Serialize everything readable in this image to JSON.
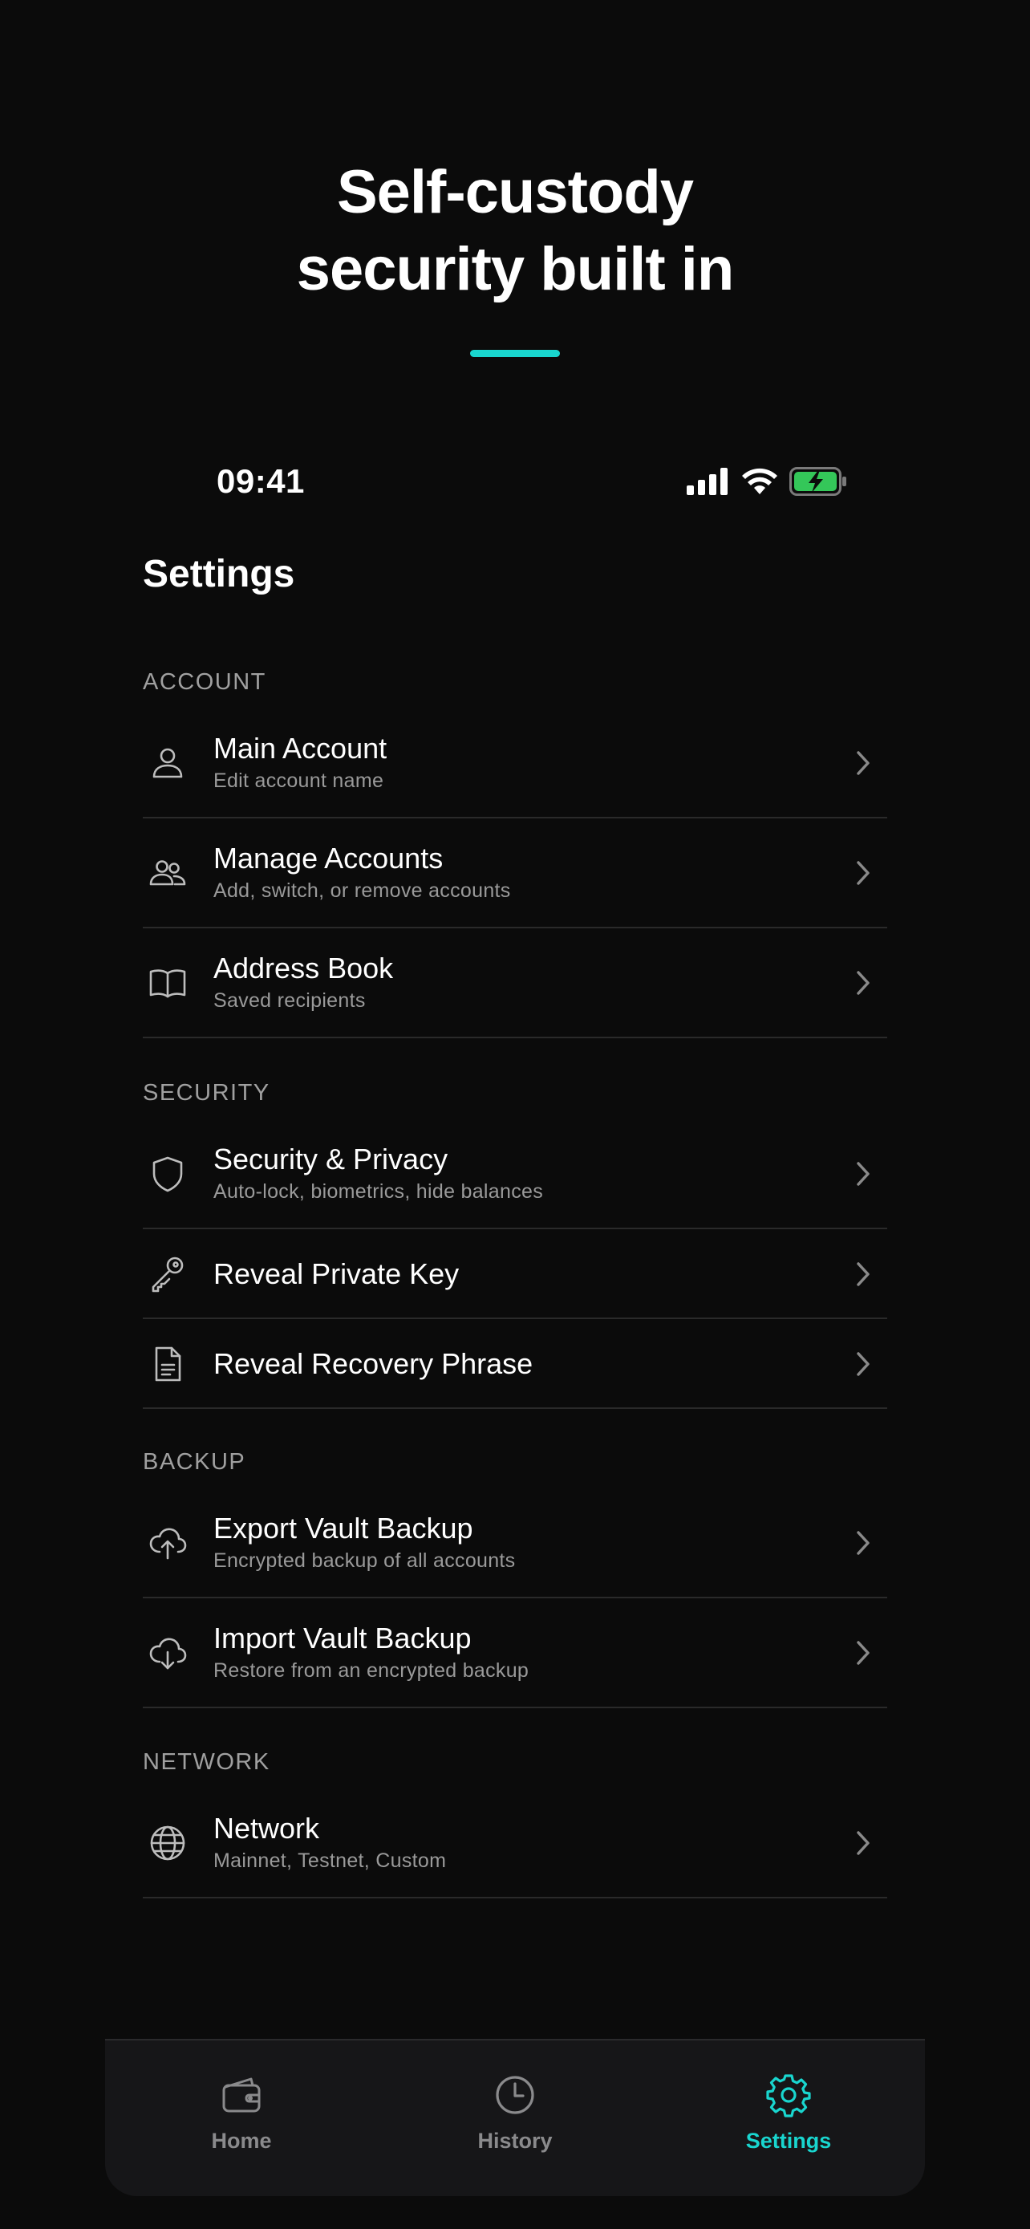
{
  "hero": {
    "title_line1": "Self-custody",
    "title_line2": "security built in",
    "accent_color": "#19d6cf"
  },
  "status_bar": {
    "time": "09:41",
    "icons": [
      "cellular-signal-icon",
      "wifi-icon",
      "battery-charging-icon"
    ],
    "battery_color": "#34c759"
  },
  "page_title": "Settings",
  "sections": {
    "account": {
      "header": "ACCOUNT",
      "items": [
        {
          "title": "Main Account",
          "subtitle": "Edit account name",
          "icon": "user-icon"
        },
        {
          "title": "Manage Accounts",
          "subtitle": "Add, switch, or remove accounts",
          "icon": "users-icon"
        },
        {
          "title": "Address Book",
          "subtitle": "Saved recipients",
          "icon": "book-icon"
        }
      ]
    },
    "security": {
      "header": "SECURITY",
      "items": [
        {
          "title": "Security & Privacy",
          "subtitle": "Auto-lock, biometrics, hide balances",
          "icon": "shield-icon"
        },
        {
          "title": "Reveal Private Key",
          "icon": "key-icon"
        },
        {
          "title": "Reveal Recovery Phrase",
          "icon": "document-icon"
        }
      ]
    },
    "backup": {
      "header": "BACKUP",
      "items": [
        {
          "title": "Export Vault Backup",
          "subtitle": "Encrypted backup of all accounts",
          "icon": "cloud-upload-icon"
        },
        {
          "title": "Import Vault Backup",
          "subtitle": "Restore from an encrypted backup",
          "icon": "cloud-download-icon"
        }
      ]
    },
    "network": {
      "header": "NETWORK",
      "items": [
        {
          "title": "Network",
          "subtitle": "Mainnet, Testnet, Custom",
          "icon": "globe-icon"
        }
      ]
    }
  },
  "tab_bar": {
    "tabs": [
      {
        "label": "Home",
        "icon": "wallet-icon",
        "active": false
      },
      {
        "label": "History",
        "icon": "clock-icon",
        "active": false
      },
      {
        "label": "Settings",
        "icon": "gear-icon",
        "active": true
      }
    ],
    "active_color": "#19d6cf",
    "inactive_color": "#8a8a8c"
  }
}
